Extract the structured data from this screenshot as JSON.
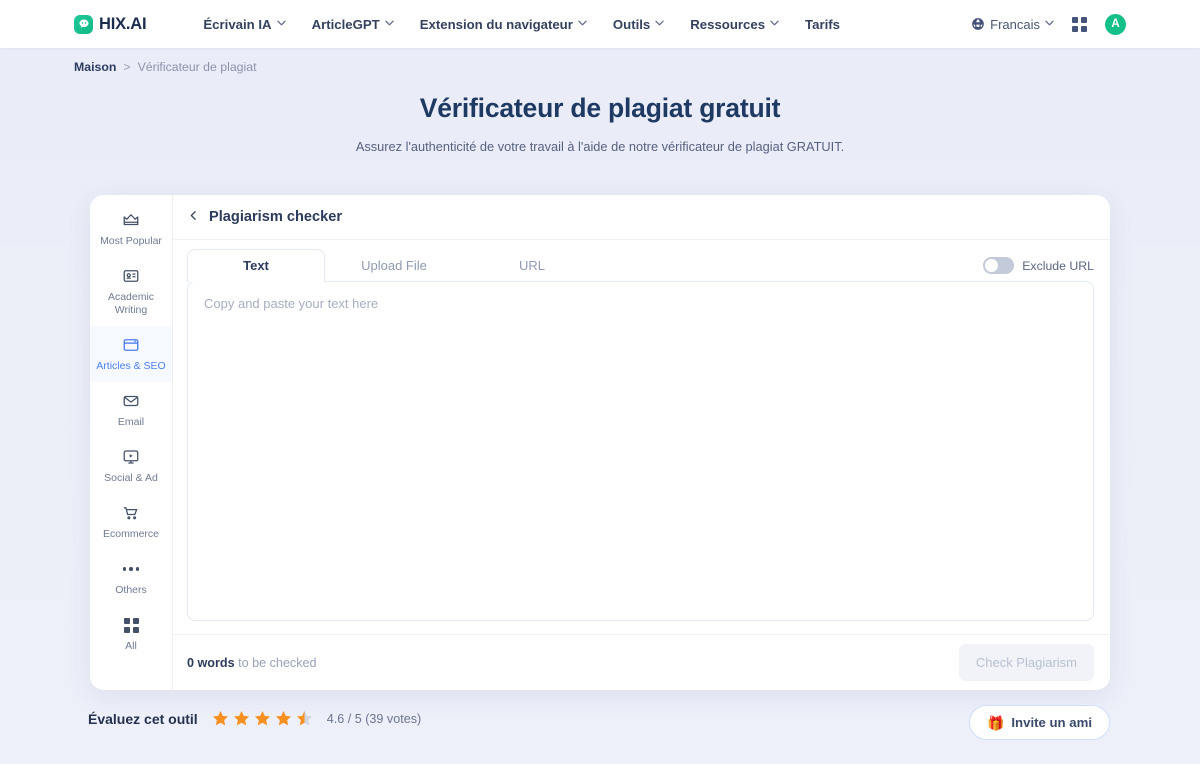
{
  "header": {
    "logo_text": "HIX.AI",
    "nav": [
      {
        "label": "Écrivain IA",
        "caret": true
      },
      {
        "label": "ArticleGPT",
        "caret": true
      },
      {
        "label": "Extension du navigateur",
        "caret": true
      },
      {
        "label": "Outils",
        "caret": true
      },
      {
        "label": "Ressources",
        "caret": true
      },
      {
        "label": "Tarifs",
        "caret": false
      }
    ],
    "language": "Francais",
    "avatar_initial": "A"
  },
  "breadcrumb": {
    "home": "Maison",
    "separator": ">",
    "current": "Vérificateur de plagiat"
  },
  "hero": {
    "title": "Vérificateur de plagiat gratuit",
    "subtitle": "Assurez l'authenticité de votre travail à l'aide de notre vérificateur de plagiat GRATUIT."
  },
  "sidebar": {
    "items": [
      {
        "label": "Most Popular",
        "icon": "crown-icon",
        "active": false
      },
      {
        "label": "Academic Writing",
        "icon": "id-card-icon",
        "active": false
      },
      {
        "label": "Articles & SEO",
        "icon": "browser-window-icon",
        "active": true
      },
      {
        "label": "Email",
        "icon": "envelope-icon",
        "active": false
      },
      {
        "label": "Social & Ad",
        "icon": "monitor-play-icon",
        "active": false
      },
      {
        "label": "Ecommerce",
        "icon": "shopping-cart-icon",
        "active": false
      },
      {
        "label": "Others",
        "icon": "ellipsis-icon",
        "active": false
      },
      {
        "label": "All",
        "icon": "grid-icon",
        "active": false
      }
    ]
  },
  "panel": {
    "back_icon": "chevron-left-icon",
    "title": "Plagiarism checker",
    "tabs": [
      {
        "label": "Text",
        "active": true
      },
      {
        "label": "Upload File",
        "active": false
      },
      {
        "label": "URL",
        "active": false
      }
    ],
    "toggle": {
      "label": "Exclude URL",
      "state": "off"
    },
    "editor_placeholder": "Copy and paste your text here",
    "word_count": "0 words",
    "word_count_suffix": " to be checked",
    "check_button": "Check Plagiarism",
    "check_button_disabled": true
  },
  "footer": {
    "rate_label": "Évaluez cet outil",
    "rating_value": 4.6,
    "rating_max": 5,
    "votes": 39,
    "rating_text": "4.6 / 5 (39 votes)",
    "invite_label": "Invite un ami",
    "invite_icon": "gift-icon"
  },
  "colors": {
    "brand_green": "#14c08a",
    "accent_blue": "#4a7ef5",
    "title_navy": "#1e3a63",
    "star_orange": "#f79021",
    "page_bg": "#eceef8"
  }
}
